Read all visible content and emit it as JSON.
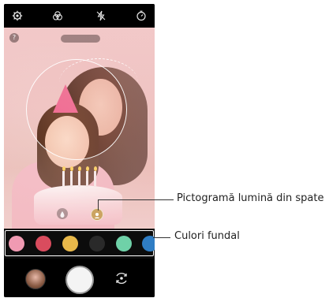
{
  "callouts": {
    "backlight_icon_label": "Pictogramă lumină din spate",
    "background_colors_label": "Culori fundal"
  },
  "top_bar": {
    "icons": [
      "gear-icon",
      "filter-icon",
      "flash-off-icon",
      "timer-icon"
    ]
  },
  "viewfinder": {
    "help_symbol": "?",
    "icons": [
      "drop-icon",
      "backlight-icon"
    ]
  },
  "background_colors": {
    "swatches": [
      "#f09ab2",
      "#d94c5e",
      "#e8b84a",
      "#2a2a2a",
      "#6fd1a8",
      "#2f7dc4"
    ]
  },
  "bottom_controls": {
    "icons": [
      "gallery-thumbnail",
      "shutter-button",
      "switch-camera-icon"
    ]
  }
}
